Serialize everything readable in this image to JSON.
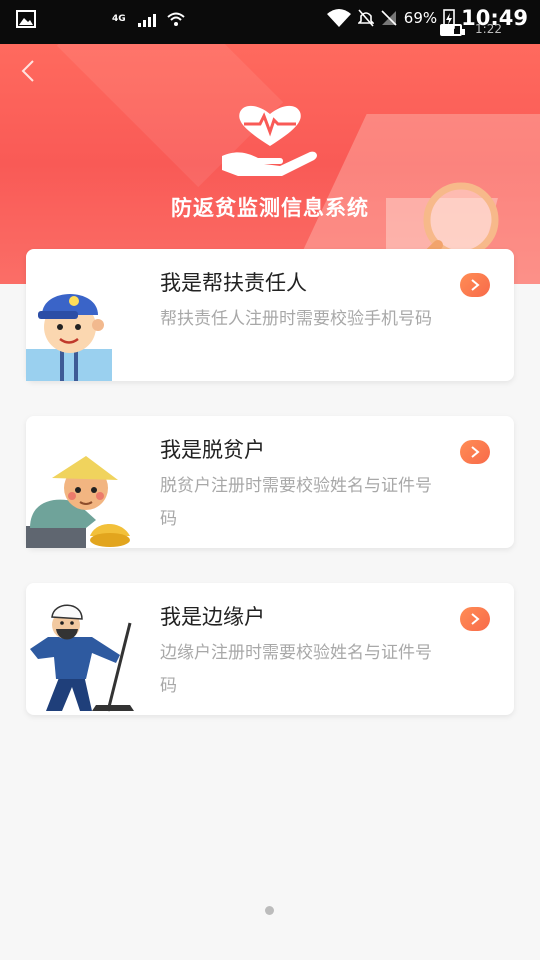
{
  "status_bar": {
    "network": "4G",
    "battery_percent": "69%",
    "time": "10:49",
    "secondary_time": "1:22",
    "battery_level": 0.69
  },
  "header": {
    "title": "防返贫监测信息系统",
    "back_icon": "chevron-left-icon",
    "logo_icon": "heart-in-hand-icon"
  },
  "options": [
    {
      "title": "我是帮扶责任人",
      "description": "帮扶责任人注册时需要校验手机号码",
      "arrow_icon": "chevron-right-icon"
    },
    {
      "title": "我是脱贫户",
      "description": "脱贫户注册时需要校验姓名与证件号码",
      "arrow_icon": "chevron-right-icon"
    },
    {
      "title": "我是边缘户",
      "description": "边缘户注册时需要校验姓名与证件号码",
      "arrow_icon": "chevron-right-icon"
    }
  ],
  "colors": {
    "accent": "#f95a56",
    "arrow": "#f86a4a"
  }
}
